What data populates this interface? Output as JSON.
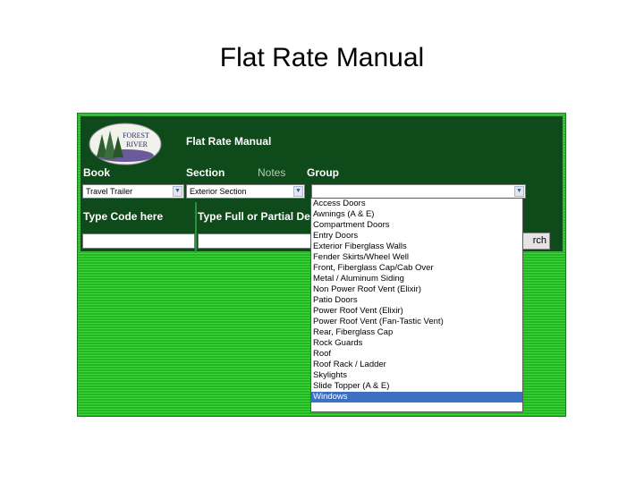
{
  "slide": {
    "title": "Flat Rate Manual"
  },
  "app": {
    "title": "Flat Rate Manual",
    "logo": {
      "text_top": "FOREST",
      "text_bottom": "RIVER"
    },
    "labels": {
      "book": "Book",
      "section": "Section",
      "notes": "Notes",
      "group": "Group",
      "type_code": "Type Code here",
      "type_full": "Type Full or Partial Des"
    },
    "book_select": {
      "value": "Travel Trailer"
    },
    "section_select": {
      "value": "Exterior Section"
    },
    "group_select": {
      "value": ""
    },
    "search_button": {
      "label": "rch"
    },
    "group_options": [
      "Access Doors",
      "Awnings (A & E)",
      "Compartment Doors",
      "Entry Doors",
      "Exterior Fiberglass Walls",
      "Fender Skirts/Wheel Well",
      "Front, Fiberglass Cap/Cab Over",
      "Metal / Aluminum Siding",
      "Non Power Roof Vent (Elixir)",
      "Patio Doors",
      "Power Roof Vent (Elixir)",
      "Power Roof Vent (Fan-Tastic Vent)",
      "Rear, Fiberglass Cap",
      "Rock Guards",
      "Roof",
      "Roof Rack / Ladder",
      "Skylights",
      "Slide Topper (A & E)",
      "Windows"
    ],
    "selected_option": "Windows",
    "colors": {
      "panel": "#0e4a1a",
      "background_green": "#33cc33",
      "selection": "#3d6fc2"
    }
  }
}
